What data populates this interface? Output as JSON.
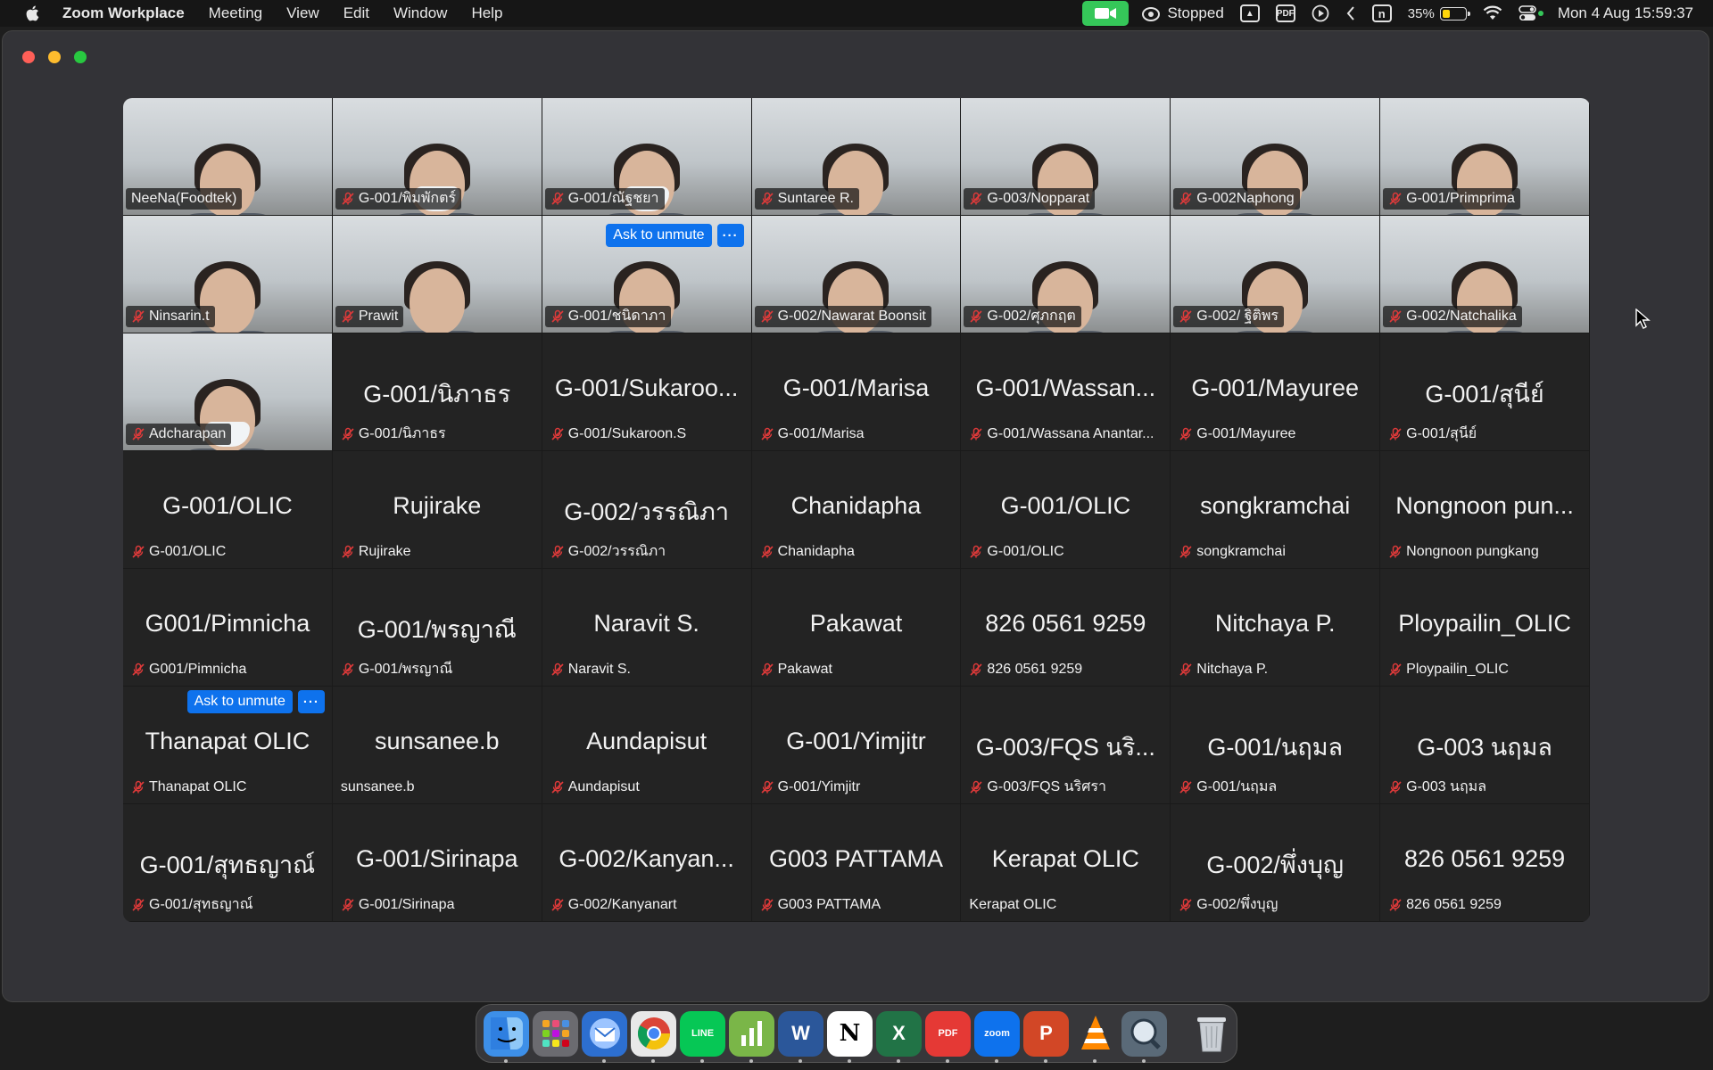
{
  "menubar": {
    "app_name": "Zoom Workplace",
    "menus": [
      "Meeting",
      "View",
      "Edit",
      "Window",
      "Help"
    ],
    "recording_status": "Stopped",
    "battery_text": "35%",
    "battery_level": 0.35,
    "clock": "Mon 4 Aug  15:59:37"
  },
  "colors": {
    "accent_blue": "#0e72ed",
    "camera_green": "#35c759",
    "mute_red": "#e03a3a"
  },
  "ask_to_unmute_label": "Ask to unmute",
  "participants": [
    {
      "name": "NeeNa(Foodtek)",
      "video": true,
      "muted": false,
      "mask": false
    },
    {
      "name": "G-001/พิมพักตร์",
      "video": true,
      "muted": true,
      "mask": true
    },
    {
      "name": "G-001/ณัฐชยา",
      "video": true,
      "muted": true,
      "mask": true
    },
    {
      "name": "Suntaree R.",
      "video": true,
      "muted": true,
      "mask": false
    },
    {
      "name": "G-003/Nopparat",
      "video": true,
      "muted": true,
      "mask": false
    },
    {
      "name": "G-002Naphong",
      "video": true,
      "muted": true,
      "mask": false
    },
    {
      "name": "G-001/Primprima",
      "video": true,
      "muted": true,
      "mask": false
    },
    {
      "name": "Ninsarin.t",
      "video": true,
      "muted": true,
      "mask": false
    },
    {
      "name": "Prawit",
      "video": true,
      "muted": true,
      "mask": false
    },
    {
      "name": "G-001/ชนิดาภา",
      "video": true,
      "muted": true,
      "mask": false,
      "ask_unmute": true
    },
    {
      "name": "G-002/Nawarat Boonsit",
      "video": true,
      "muted": true,
      "mask": false
    },
    {
      "name": "G-002/ศุภกฤต",
      "video": true,
      "muted": true,
      "mask": false
    },
    {
      "name": "G-002/ ฐิติพร",
      "video": true,
      "muted": true,
      "mask": false
    },
    {
      "name": "G-002/Natchalika",
      "video": true,
      "muted": true,
      "mask": false
    },
    {
      "name": "Adcharapan",
      "video": true,
      "muted": true,
      "mask": true
    },
    {
      "big": "G-001/นิภาธร",
      "name": "G-001/นิภาธร",
      "video": false,
      "muted": true
    },
    {
      "big": "G-001/Sukaroo...",
      "name": "G-001/Sukaroon.S",
      "video": false,
      "muted": true
    },
    {
      "big": "G-001/Marisa",
      "name": "G-001/Marisa",
      "video": false,
      "muted": true
    },
    {
      "big": "G-001/Wassan...",
      "name": "G-001/Wassana Anantar...",
      "video": false,
      "muted": true
    },
    {
      "big": "G-001/Mayuree",
      "name": "G-001/Mayuree",
      "video": false,
      "muted": true
    },
    {
      "big": "G-001/สุนีย์",
      "name": "G-001/สุนีย์",
      "video": false,
      "muted": true
    },
    {
      "big": "G-001/OLIC",
      "name": "G-001/OLIC",
      "video": false,
      "muted": true
    },
    {
      "big": "Rujirake",
      "name": "Rujirake",
      "video": false,
      "muted": true
    },
    {
      "big": "G-002/วรรณิภา",
      "name": "G-002/วรรณิภา",
      "video": false,
      "muted": true
    },
    {
      "big": "Chanidapha",
      "name": "Chanidapha",
      "video": false,
      "muted": true
    },
    {
      "big": "G-001/OLIC",
      "name": "G-001/OLIC",
      "video": false,
      "muted": true
    },
    {
      "big": "songkramchai",
      "name": "songkramchai",
      "video": false,
      "muted": true
    },
    {
      "big": "Nongnoon pun...",
      "name": "Nongnoon pungkang",
      "video": false,
      "muted": true
    },
    {
      "big": "G001/Pimnicha",
      "name": "G001/Pimnicha",
      "video": false,
      "muted": true
    },
    {
      "big": "G-001/พรญาณี",
      "name": "G-001/พรญาณี",
      "video": false,
      "muted": true
    },
    {
      "big": "Naravit S.",
      "name": "Naravit S.",
      "video": false,
      "muted": true
    },
    {
      "big": "Pakawat",
      "name": "Pakawat",
      "video": false,
      "muted": true
    },
    {
      "big": "826 0561 9259",
      "name": "826 0561 9259",
      "video": false,
      "muted": true
    },
    {
      "big": "Nitchaya P.",
      "name": "Nitchaya P.",
      "video": false,
      "muted": true
    },
    {
      "big": "Ploypailin_OLIC",
      "name": "Ploypailin_OLIC",
      "video": false,
      "muted": true
    },
    {
      "big": "Thanapat OLIC",
      "name": "Thanapat OLIC",
      "video": false,
      "muted": true,
      "ask_unmute": true
    },
    {
      "big": "sunsanee.b",
      "name": "sunsanee.b",
      "video": false,
      "muted": false
    },
    {
      "big": "Aundapisut",
      "name": "Aundapisut",
      "video": false,
      "muted": true
    },
    {
      "big": "G-001/Yimjitr",
      "name": "G-001/Yimjitr",
      "video": false,
      "muted": true
    },
    {
      "big": "G-003/FQS นริ...",
      "name": "G-003/FQS นริศรา",
      "video": false,
      "muted": true
    },
    {
      "big": "G-001/นฤมล",
      "name": "G-001/นฤมล",
      "video": false,
      "muted": true
    },
    {
      "big": "G-003 นฤมล",
      "name": "G-003 นฤมล",
      "video": false,
      "muted": true
    },
    {
      "big": "G-001/สุทธญาณ์",
      "name": "G-001/สุทธญาณ์",
      "video": false,
      "muted": true
    },
    {
      "big": "G-001/Sirinapa",
      "name": "G-001/Sirinapa",
      "video": false,
      "muted": true
    },
    {
      "big": "G-002/Kanyan...",
      "name": "G-002/Kanyanart",
      "video": false,
      "muted": true
    },
    {
      "big": "G003 PATTAMA",
      "name": "G003 PATTAMA",
      "video": false,
      "muted": true
    },
    {
      "big": "Kerapat OLIC",
      "name": "Kerapat OLIC",
      "video": false,
      "muted": false
    },
    {
      "big": "G-002/พึ่งบุญ",
      "name": "G-002/พึ่งบุญ",
      "video": false,
      "muted": true
    },
    {
      "big": "826 0561 9259",
      "name": "826 0561 9259",
      "video": false,
      "muted": true
    }
  ],
  "dock": {
    "items": [
      {
        "icon": "finder-icon",
        "label": "",
        "bg": "#3d8fe8",
        "running": true
      },
      {
        "icon": "launchpad-icon",
        "label": "",
        "bg": "#6b6b70",
        "running": false
      },
      {
        "icon": "thunderbird-icon",
        "label": "",
        "bg": "#2d6fd0",
        "running": true
      },
      {
        "icon": "chrome-icon",
        "label": "",
        "bg": "#e8e8e8",
        "running": true
      },
      {
        "icon": "line-icon",
        "label": "LINE",
        "bg": "#06c755",
        "running": true
      },
      {
        "icon": "numbers-icon",
        "label": "",
        "bg": "#7ab648",
        "running": true
      },
      {
        "icon": "word-icon",
        "label": "W",
        "bg": "#2b579a",
        "running": true
      },
      {
        "icon": "notion-icon",
        "label": "N",
        "bg": "#ffffff",
        "running": true
      },
      {
        "icon": "excel-icon",
        "label": "X",
        "bg": "#217346",
        "running": true
      },
      {
        "icon": "pdf-icon",
        "label": "PDF",
        "bg": "#e53935",
        "running": true
      },
      {
        "icon": "zoom-icon",
        "label": "zoom",
        "bg": "#0e72ed",
        "running": true
      },
      {
        "icon": "powerpoint-icon",
        "label": "P",
        "bg": "#d24726",
        "running": true
      },
      {
        "icon": "vlc-icon",
        "label": "",
        "bg": "transparent",
        "running": true
      },
      {
        "icon": "quicktime-icon",
        "label": "",
        "bg": "#5a6a78",
        "running": true
      }
    ],
    "trash": {
      "icon": "trash-icon"
    }
  }
}
